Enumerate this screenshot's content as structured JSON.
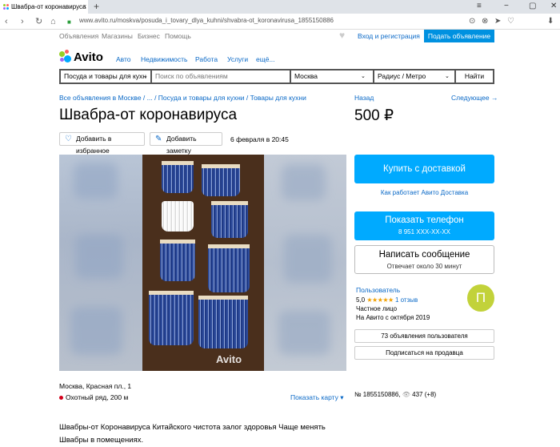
{
  "browser": {
    "tab_title": "Швабра-от коронавируса",
    "tab_close": "×",
    "new_tab": "+",
    "url": "www.avito.ru/moskva/posuda_i_tovary_dlya_kuhni/shvabra-ot_koronavirusa_1855150886",
    "nav": {
      "back": "‹",
      "forward": "›",
      "reload": "↻",
      "home": "⌂",
      "lock": "🔒"
    },
    "window": {
      "menu": "≡",
      "minimize": "−",
      "maximize": "▢",
      "close": "✕"
    },
    "address_icons": {
      "camera": "⊙",
      "block": "⊗",
      "send": "➤",
      "heart": "♡",
      "download": "⬇"
    }
  },
  "site": {
    "top_links": [
      "Объявления",
      "Магазины",
      "Бизнес",
      "Помощь"
    ],
    "login": "Вход и регистрация",
    "post_ad": "Подать объявление",
    "logo": "Avito",
    "categories": [
      "Авто",
      "Недвижимость",
      "Работа",
      "Услуги",
      "ещё..."
    ],
    "search": {
      "category": "Посуда и товары для кухн",
      "placeholder": "Поиск по объявлениям",
      "city": "Москва",
      "radius": "Радиус / Метро",
      "find": "Найти"
    }
  },
  "listing": {
    "breadcrumb": "Все объявления в Москве / ... / Посуда и товары для кухни / Товары для кухни",
    "back": "Назад",
    "next": "Следующее →",
    "title": "Швабра-от коронавируса",
    "price": "500 ₽",
    "add_favorite": "Добавить в избранное",
    "add_note": "Добавить заметку",
    "date": "6 февраля в 20:45",
    "watermark": "Avito",
    "address": "Москва, Красная пл., 1",
    "metro": "Охотный ряд, 200 м",
    "show_map": "Показать карту ▾",
    "ad_number": "№ 1855150886,",
    "views": "437 (+8)",
    "description": "Швабры-от Коронавируса Китайского чистота залог здоровья Чаще менять Швабры в помещениях."
  },
  "actions": {
    "buy_delivery": "Купить с доставкой",
    "how_delivery": "Как работает Авито Доставка",
    "show_phone": "Показать телефон",
    "phone_mask": "8 951 XXX-XX-XX",
    "write_message": "Написать сообщение",
    "reply_time": "Отвечает около 30 минут"
  },
  "seller": {
    "name": "Пользователь",
    "rating": "5,0",
    "stars": "★★★★★",
    "reviews": "1 отзыв",
    "type": "Частное лицо",
    "since": "На Авито с октября 2019",
    "avatar_letter": "П",
    "ads_count_btn": "73 объявления пользователя",
    "subscribe_btn": "Подписаться на продавца"
  },
  "colors": {
    "accent": "#00aaff",
    "link": "#0a69c7",
    "avatar": "#c2d23a"
  }
}
